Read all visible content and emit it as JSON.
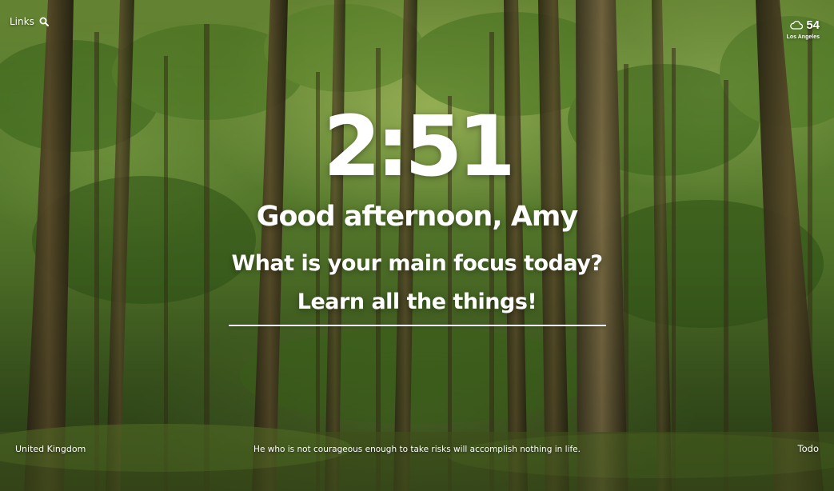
{
  "top_left": {
    "links_label": "Links",
    "search_icon": "search-icon"
  },
  "weather": {
    "icon": "cloud-icon",
    "temperature": "54",
    "location": "Los Angeles"
  },
  "clock": {
    "time": "2:51"
  },
  "greeting": {
    "text": "Good afternoon, Amy"
  },
  "focus": {
    "prompt": "What is your main focus today?",
    "value": "Learn all the things!"
  },
  "footer": {
    "location": "United Kingdom",
    "quote": "He who is not courageous enough to take risks will accomplish nothing in life.",
    "todo_label": "Todo"
  },
  "colors": {
    "text": "#ffffff",
    "background_green": "#5d8230"
  }
}
